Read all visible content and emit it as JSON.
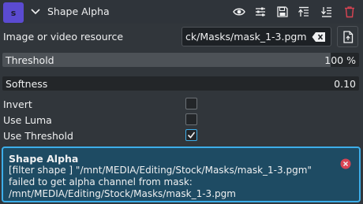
{
  "header": {
    "badge": "s",
    "title": "Shape Alpha",
    "icons": [
      "chevron-down-icon",
      "eye-icon",
      "sliders-icon",
      "save-icon",
      "align-top-icon",
      "align-bottom-icon",
      "trash-icon"
    ]
  },
  "resource": {
    "label": "Image or video resource",
    "value": "ck/Masks/mask_1-3.pgm",
    "clear_icon": "backspace-icon",
    "open_icon": "file-icon"
  },
  "threshold": {
    "name": "Threshold",
    "value": "100 %",
    "level": 0.92
  },
  "softness": {
    "name": "Softness",
    "value": "0.10",
    "level": 0.0
  },
  "options": [
    {
      "label": "Invert",
      "checked": false
    },
    {
      "label": "Use Luma",
      "checked": false
    },
    {
      "label": "Use Threshold",
      "checked": true
    }
  ],
  "message": {
    "title": "Shape Alpha",
    "body": "[filter shape ] \"/mnt/MEDIA/Editing/Stock/Masks/mask_1-3.pgm\" failed to get alpha channel from mask: /mnt/MEDIA/Editing/Stock/Masks/mask_1-3.pgm",
    "close_icon": "close-circle-icon"
  },
  "colors": {
    "accent": "#3daee9",
    "badge": "#5b4bd1",
    "delete": "#da4453",
    "message_bg": "#1e4b63"
  }
}
